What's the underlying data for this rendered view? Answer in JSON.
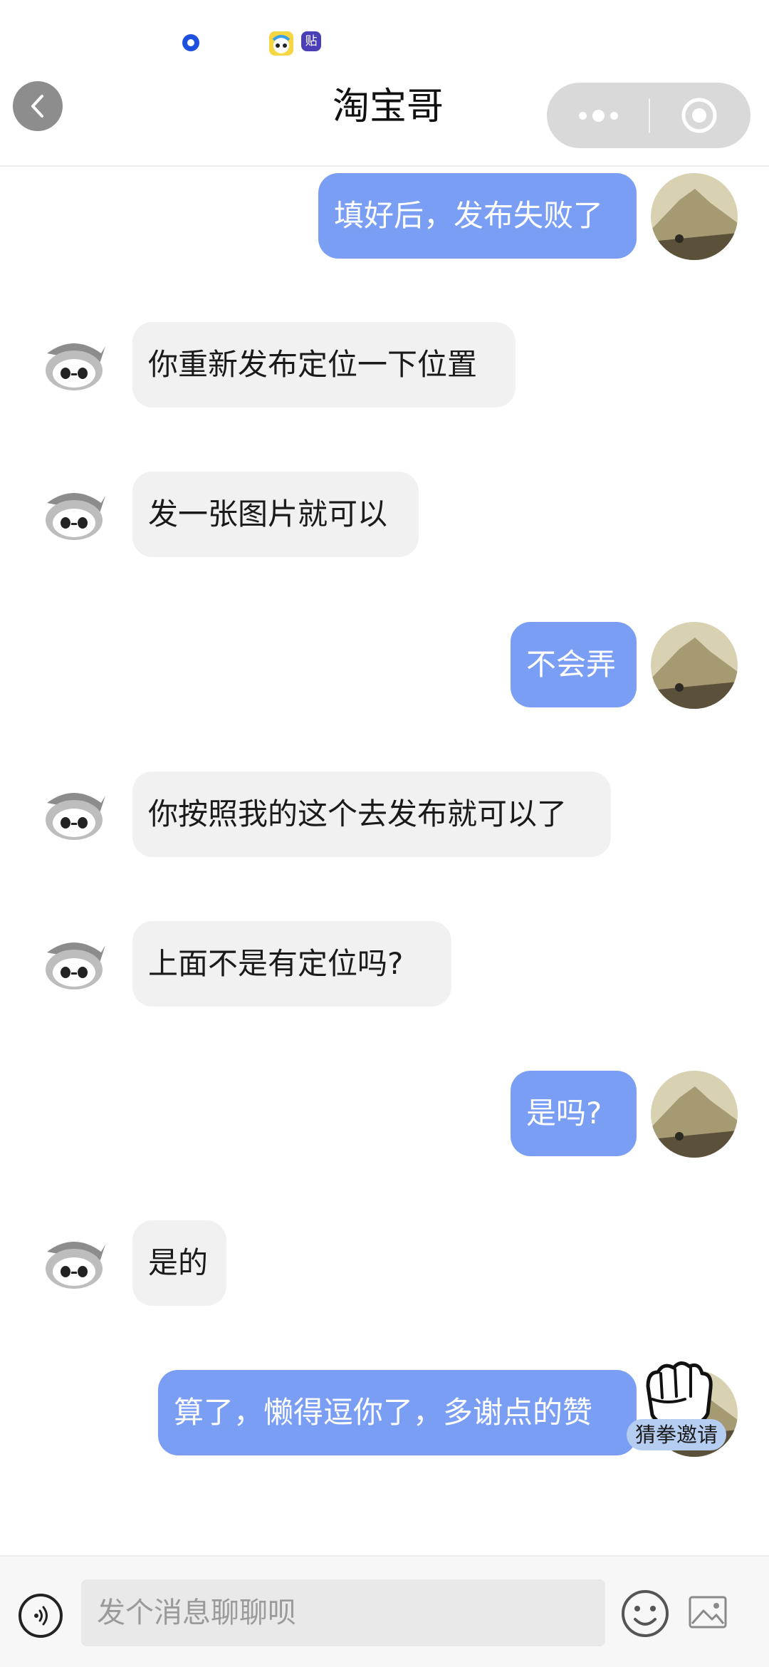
{
  "status_bar": {
    "app_badge_2": "贴"
  },
  "nav": {
    "title": "淘宝哥"
  },
  "messages": [
    {
      "side": "out",
      "text": "填好后，发布失败了"
    },
    {
      "side": "in",
      "text": "你重新发布定位一下位置"
    },
    {
      "side": "in",
      "text": "发一张图片就可以"
    },
    {
      "side": "out",
      "text": "不会弄"
    },
    {
      "side": "in",
      "text": "你按照我的这个去发布就可以了"
    },
    {
      "side": "in",
      "text": "上面不是有定位吗?"
    },
    {
      "side": "out",
      "text": "是吗?"
    },
    {
      "side": "in",
      "text": "是的"
    },
    {
      "side": "out",
      "text": "算了，懒得逗你了，多谢点的赞"
    }
  ],
  "game_badge": {
    "label": "猜拳邀请"
  },
  "input_bar": {
    "placeholder": "发个消息聊聊呗"
  },
  "colors": {
    "outgoing_bubble": "#7b9ef5",
    "incoming_bubble": "#f1f1f2",
    "capsule": "#d9d9d9"
  },
  "icons": {
    "back": "chevron-left-icon",
    "more": "more-dots-icon",
    "close": "target-circle-icon",
    "voice": "voice-icon",
    "emoji": "smile-icon",
    "image": "image-icon",
    "game": "fist-icon"
  }
}
